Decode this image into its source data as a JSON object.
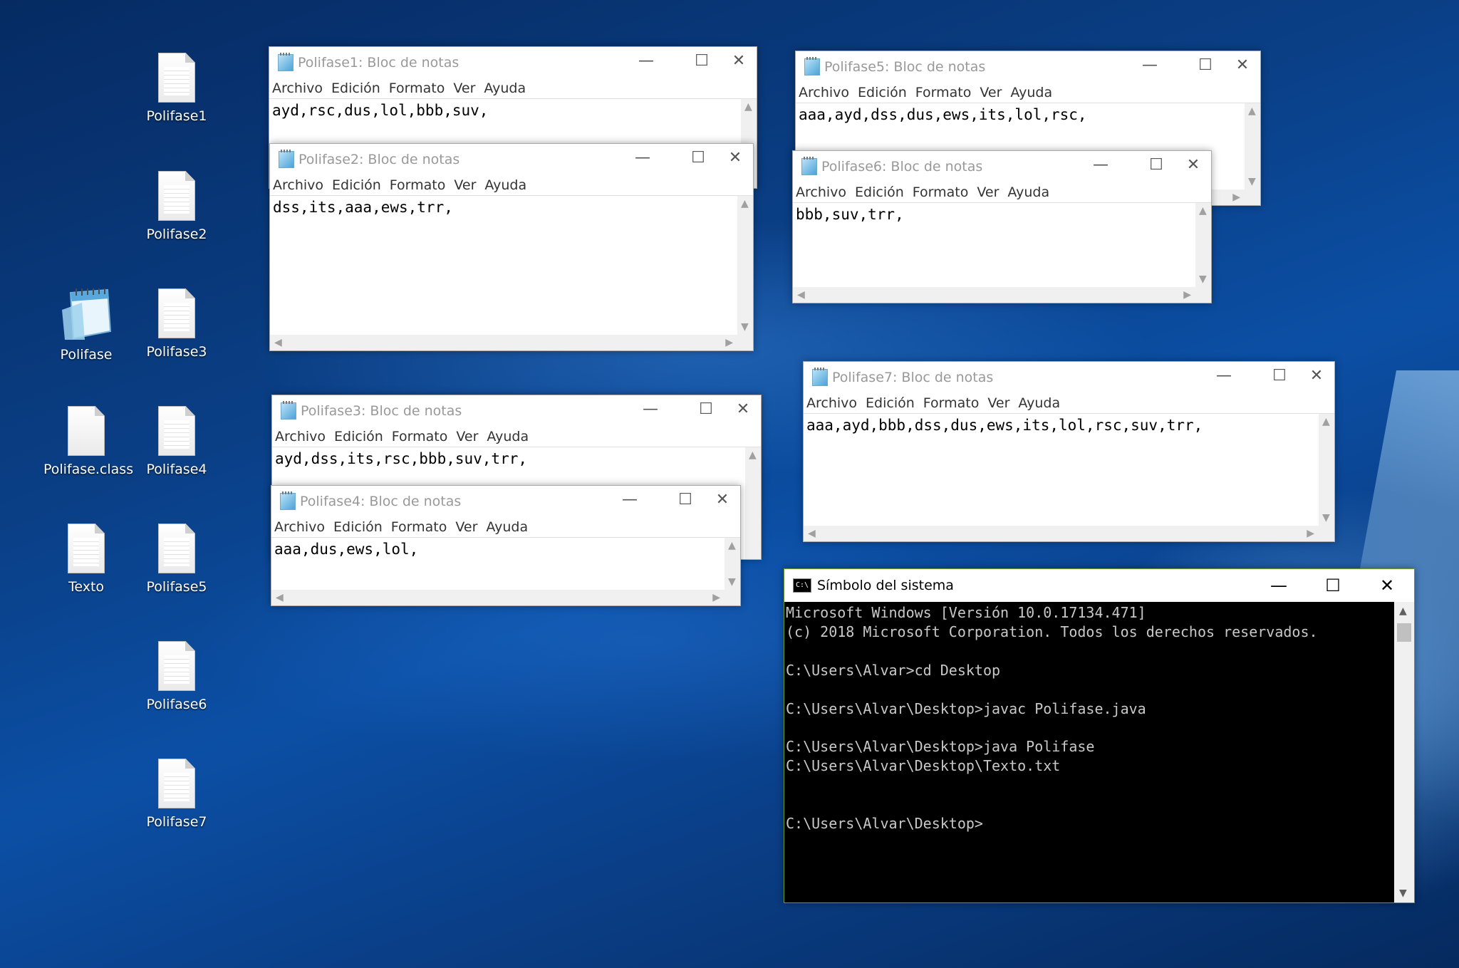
{
  "desktop": {
    "icons": [
      {
        "label": "Polifase1"
      },
      {
        "label": "Polifase2"
      },
      {
        "label": "Polifase"
      },
      {
        "label": "Polifase3"
      },
      {
        "label": "Polifase.class"
      },
      {
        "label": "Polifase4"
      },
      {
        "label": "Texto"
      },
      {
        "label": "Polifase5"
      },
      {
        "label": "Polifase6"
      },
      {
        "label": "Polifase7"
      }
    ]
  },
  "notepad_menu": {
    "file": "Archivo",
    "edit": "Edición",
    "format": "Formato",
    "view": "Ver",
    "help": "Ayuda"
  },
  "window_controls": {
    "minimize": "—",
    "maximize": "☐",
    "close": "✕"
  },
  "windows": [
    {
      "title": "Polifase1: Bloc de notas",
      "content": "ayd,rsc,dus,lol,bbb,suv,"
    },
    {
      "title": "Polifase2: Bloc de notas",
      "content": "dss,its,aaa,ews,trr,"
    },
    {
      "title": "Polifase3: Bloc de notas",
      "content": "ayd,dss,its,rsc,bbb,suv,trr,"
    },
    {
      "title": "Polifase4: Bloc de notas",
      "content": "aaa,dus,ews,lol,"
    },
    {
      "title": "Polifase5: Bloc de notas",
      "content": "aaa,ayd,dss,dus,ews,its,lol,rsc,"
    },
    {
      "title": "Polifase6: Bloc de notas",
      "content": "bbb,suv,trr,"
    },
    {
      "title": "Polifase7: Bloc de notas",
      "content": "aaa,ayd,bbb,dss,dus,ews,its,lol,rsc,suv,trr,"
    }
  ],
  "cmd": {
    "title": "Símbolo del sistema",
    "icon_text": "C:\\",
    "lines": [
      "Microsoft Windows [Versión 10.0.17134.471]",
      "(c) 2018 Microsoft Corporation. Todos los derechos reservados.",
      "",
      "C:\\Users\\Alvar>cd Desktop",
      "",
      "C:\\Users\\Alvar\\Desktop>javac Polifase.java",
      "",
      "C:\\Users\\Alvar\\Desktop>java Polifase",
      "C:\\Users\\Alvar\\Desktop\\Texto.txt",
      "",
      "",
      "C:\\Users\\Alvar\\Desktop>"
    ]
  }
}
